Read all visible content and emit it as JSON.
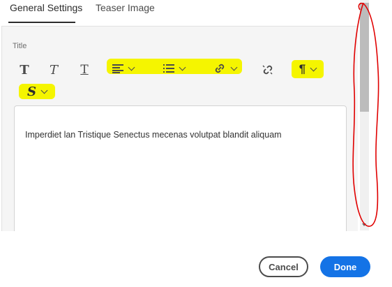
{
  "tabs": [
    {
      "label": "General Settings",
      "active": true
    },
    {
      "label": "Teaser Image",
      "active": false
    }
  ],
  "field": {
    "label": "Title"
  },
  "toolbar": {
    "buttons": [
      {
        "icon": "bold-icon",
        "glyph": "T"
      },
      {
        "icon": "italic-icon",
        "glyph": "T"
      },
      {
        "icon": "underline-icon",
        "glyph": "T"
      },
      {
        "icon": "align-icon",
        "highlighted": true,
        "dropdown": true
      },
      {
        "icon": "list-icon",
        "highlighted": true,
        "dropdown": true
      },
      {
        "icon": "link-icon",
        "highlighted": true,
        "dropdown": true
      },
      {
        "icon": "unlink-icon"
      },
      {
        "icon": "paragraph-icon",
        "glyph": "¶",
        "highlighted": true,
        "dropdown": true
      },
      {
        "icon": "style-icon",
        "glyph": "S",
        "highlighted": true,
        "dropdown": true
      }
    ]
  },
  "editor": {
    "text": "Imperdiet lan Tristique Senectus mecenas volutpat blandit aliquam"
  },
  "footer": {
    "cancel_label": "Cancel",
    "done_label": "Done"
  },
  "colors": {
    "accent": "#1473e6",
    "highlight": "#f5f500",
    "annotation": "#e00000"
  }
}
